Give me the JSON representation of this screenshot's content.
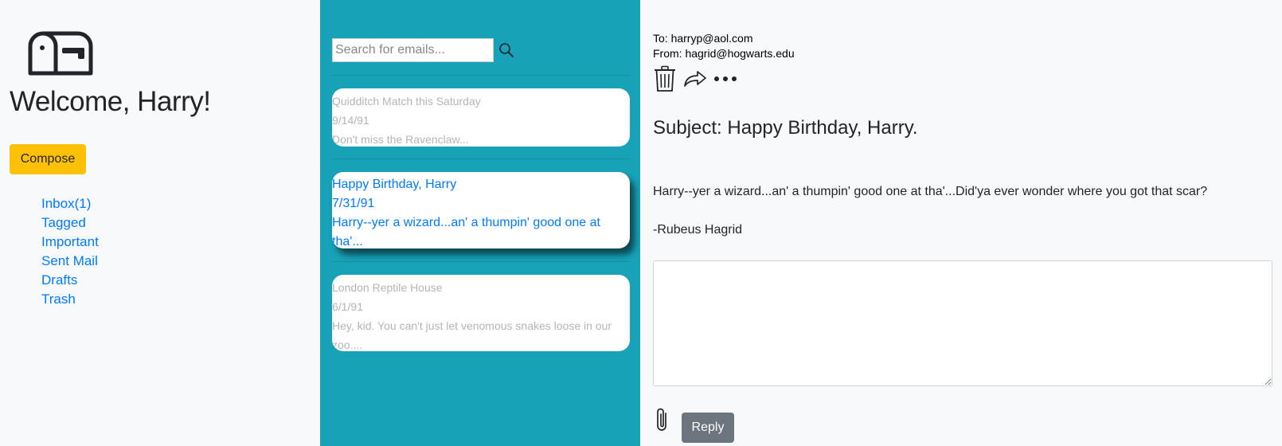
{
  "sidebar": {
    "logo_icon": "mailbox-icon",
    "welcome": "Welcome, Harry!",
    "compose_label": "Compose",
    "nav": [
      {
        "label": "Inbox(1)"
      },
      {
        "label": "Tagged"
      },
      {
        "label": "Important"
      },
      {
        "label": "Sent Mail"
      },
      {
        "label": "Drafts"
      },
      {
        "label": "Trash"
      }
    ]
  },
  "list": {
    "search_placeholder": "Search for emails...",
    "search_icon": "search-icon",
    "emails": [
      {
        "subject": "Quidditch Match this Saturday",
        "date": "9/14/91",
        "preview": "Don't miss the Ravenclaw...",
        "state": "read"
      },
      {
        "subject": "Happy Birthday, Harry",
        "date": "7/31/91",
        "preview": "Harry--yer a wizard...an' a thumpin' good one at tha'...",
        "state": "selected"
      },
      {
        "subject": "London Reptile House",
        "date": "6/1/91",
        "preview": "Hey, kid. You can't just let venomous snakes loose in our zoo....",
        "state": "read"
      }
    ]
  },
  "reader": {
    "to": "To: harryp@aol.com",
    "from": "From: hagrid@hogwarts.edu",
    "action_icons": [
      "trash-icon",
      "forward-icon",
      "more-icon"
    ],
    "subject": "Subject: Happy Birthday, Harry.",
    "body": "Harry--yer a wizard...an' a thumpin' good one at tha'...Did'ya ever wonder where you got that scar?",
    "signature": "-Rubeus Hagrid",
    "reply_value": "",
    "attach_icon": "paperclip-icon",
    "reply_label": "Reply"
  },
  "colors": {
    "accent_link": "#007bff",
    "compose_bg": "#ffc107",
    "list_panel_bg": "#17a2b8",
    "reply_btn_bg": "#6c757d"
  }
}
